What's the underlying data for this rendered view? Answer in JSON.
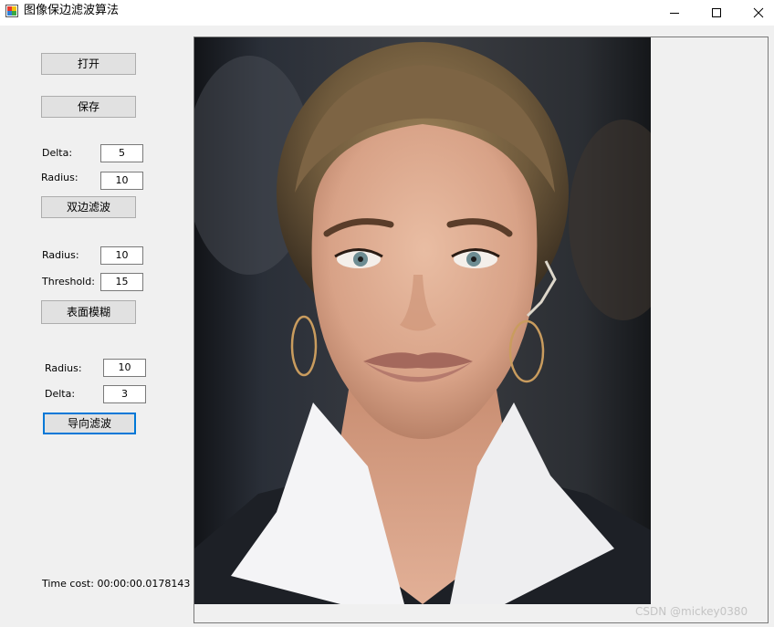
{
  "window": {
    "title": "图像保边滤波算法",
    "controls": [
      "minimize",
      "maximize",
      "close"
    ]
  },
  "toolbar": {
    "open_label": "打开",
    "save_label": "保存"
  },
  "bilateral": {
    "delta_label": "Delta:",
    "delta_value": "5",
    "radius_label": "Radius:",
    "radius_value": "10",
    "button_label": "双边滤波"
  },
  "surface_blur": {
    "radius_label": "Radius:",
    "radius_value": "10",
    "threshold_label": "Threshold:",
    "threshold_value": "15",
    "button_label": "表面模糊"
  },
  "guided": {
    "radius_label": "Radius:",
    "radius_value": "10",
    "delta_label": "Delta:",
    "delta_value": "3",
    "button_label": "导向滤波"
  },
  "status": {
    "time_cost": "Time cost: 00:00:00.0178143"
  },
  "watermark": "CSDN @mickey0380",
  "colors": {
    "window_bg": "#f0f0f0",
    "titlebar_bg": "#ffffff",
    "button_bg": "#e1e1e1",
    "button_border": "#adadad",
    "focus_border": "#0078d7"
  }
}
